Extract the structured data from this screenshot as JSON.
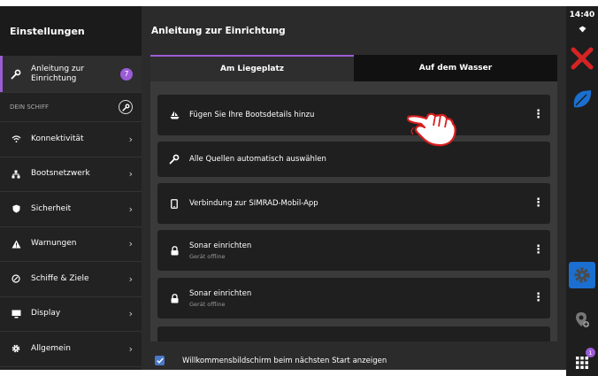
{
  "status": {
    "time": "14:40"
  },
  "sidebar": {
    "title": "Einstellungen",
    "active_item": {
      "label": "Anleitung zur Einrichtung",
      "badge": "7"
    },
    "section_label": "DEIN SCHIFF",
    "items": [
      {
        "label": "Konnektivität",
        "icon": "wifi-icon"
      },
      {
        "label": "Bootsnetzwerk",
        "icon": "network-icon"
      },
      {
        "label": "Sicherheit",
        "icon": "shield-icon"
      },
      {
        "label": "Warnungen",
        "icon": "warning-icon"
      },
      {
        "label": "Schiffe & Ziele",
        "icon": "target-icon"
      },
      {
        "label": "Display",
        "icon": "display-icon"
      },
      {
        "label": "Allgemein",
        "icon": "gear-icon"
      }
    ]
  },
  "main": {
    "title": "Anleitung zur Einrichtung",
    "tabs": [
      {
        "label": "Am Liegeplatz",
        "active": true
      },
      {
        "label": "Auf dem Wasser",
        "active": false
      }
    ],
    "rows": [
      {
        "label": "Fügen Sie Ihre Bootsdetails hinzu",
        "icon": "boat-icon"
      },
      {
        "label": "Alle Quellen automatisch auswählen",
        "icon": "wrench-icon"
      },
      {
        "label": "Verbindung zur SIMRAD-Mobil-App",
        "icon": "phone-icon"
      },
      {
        "label": "Sonar einrichten",
        "sub": "Gerät offline",
        "icon": "lock-icon"
      },
      {
        "label": "Sonar einrichten",
        "sub": "Gerät offline",
        "icon": "lock-icon"
      }
    ],
    "footer_label": "Willkommensbildschirm beim nächsten Start anzeigen"
  },
  "rightbar": {
    "apps_badge": "1"
  },
  "colors": {
    "accent": "#9b5cd6",
    "app_blue": "#1a6fd0",
    "app_red": "#d42424",
    "checkbox": "#4a78c8"
  }
}
